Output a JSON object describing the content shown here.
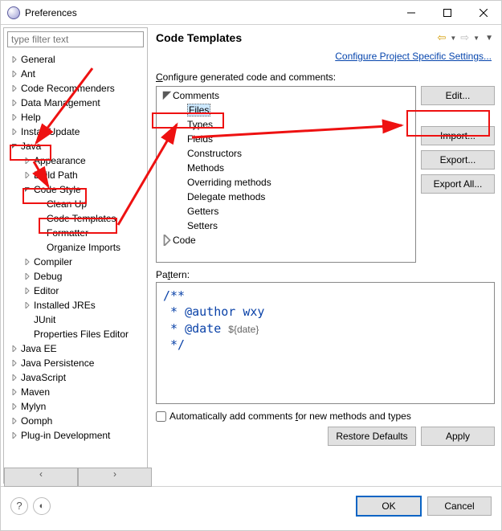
{
  "window": {
    "title": "Preferences"
  },
  "filter_placeholder": "type filter text",
  "sidebar_items": [
    {
      "lvl": 1,
      "exp": "c",
      "label": "General"
    },
    {
      "lvl": 1,
      "exp": "c",
      "label": "Ant"
    },
    {
      "lvl": 1,
      "exp": "c",
      "label": "Code Recommenders"
    },
    {
      "lvl": 1,
      "exp": "c",
      "label": "Data Management"
    },
    {
      "lvl": 1,
      "exp": "c",
      "label": "Help"
    },
    {
      "lvl": 1,
      "exp": "c",
      "label": "Install/Update"
    },
    {
      "lvl": 1,
      "exp": "o",
      "label": "Java"
    },
    {
      "lvl": 2,
      "exp": "c",
      "label": "Appearance"
    },
    {
      "lvl": 2,
      "exp": "c",
      "label": "Build Path"
    },
    {
      "lvl": 2,
      "exp": "o",
      "label": "Code Style"
    },
    {
      "lvl": 3,
      "exp": "n",
      "label": "Clean Up"
    },
    {
      "lvl": 3,
      "exp": "n",
      "label": "Code Templates"
    },
    {
      "lvl": 3,
      "exp": "n",
      "label": "Formatter"
    },
    {
      "lvl": 3,
      "exp": "n",
      "label": "Organize Imports"
    },
    {
      "lvl": 2,
      "exp": "c",
      "label": "Compiler"
    },
    {
      "lvl": 2,
      "exp": "c",
      "label": "Debug"
    },
    {
      "lvl": 2,
      "exp": "c",
      "label": "Editor"
    },
    {
      "lvl": 2,
      "exp": "c",
      "label": "Installed JREs"
    },
    {
      "lvl": 2,
      "exp": "n",
      "label": "JUnit"
    },
    {
      "lvl": 2,
      "exp": "n",
      "label": "Properties Files Editor"
    },
    {
      "lvl": 1,
      "exp": "c",
      "label": "Java EE"
    },
    {
      "lvl": 1,
      "exp": "c",
      "label": "Java Persistence"
    },
    {
      "lvl": 1,
      "exp": "c",
      "label": "JavaScript"
    },
    {
      "lvl": 1,
      "exp": "c",
      "label": "Maven"
    },
    {
      "lvl": 1,
      "exp": "c",
      "label": "Mylyn"
    },
    {
      "lvl": 1,
      "exp": "c",
      "label": "Oomph"
    },
    {
      "lvl": 1,
      "exp": "c",
      "label": "Plug-in Development"
    }
  ],
  "page": {
    "heading": "Code Templates",
    "link": "Configure Project Specific Settings...",
    "configure_label_pre": "C",
    "configure_label_post": "onfigure generated code and comments:",
    "templates": [
      {
        "lvl": 1,
        "exp": "o",
        "label": "Comments",
        "sel": false
      },
      {
        "lvl": 2,
        "exp": "n",
        "label": "Files",
        "sel": true
      },
      {
        "lvl": 2,
        "exp": "n",
        "label": "Types",
        "sel": false
      },
      {
        "lvl": 2,
        "exp": "n",
        "label": "Fields",
        "sel": false
      },
      {
        "lvl": 2,
        "exp": "n",
        "label": "Constructors",
        "sel": false
      },
      {
        "lvl": 2,
        "exp": "n",
        "label": "Methods",
        "sel": false
      },
      {
        "lvl": 2,
        "exp": "n",
        "label": "Overriding methods",
        "sel": false
      },
      {
        "lvl": 2,
        "exp": "n",
        "label": "Delegate methods",
        "sel": false
      },
      {
        "lvl": 2,
        "exp": "n",
        "label": "Getters",
        "sel": false
      },
      {
        "lvl": 2,
        "exp": "n",
        "label": "Setters",
        "sel": false
      },
      {
        "lvl": 1,
        "exp": "c",
        "label": "Code",
        "sel": false
      }
    ],
    "buttons": {
      "edit": "Edit...",
      "import": "Import...",
      "export": "Export...",
      "export_all": "Export All..."
    },
    "pattern_label_pre": "Pa",
    "pattern_label_u": "t",
    "pattern_label_post": "tern:",
    "pattern_text": "/**\n * @author wxy\n * @date ${date}\n */",
    "autocomment_pre": "Automatically add comments ",
    "autocomment_u": "f",
    "autocomment_post": "or new methods and types",
    "restore": "Restore Defaults",
    "apply": "Apply"
  },
  "footer": {
    "ok": "OK",
    "cancel": "Cancel"
  }
}
